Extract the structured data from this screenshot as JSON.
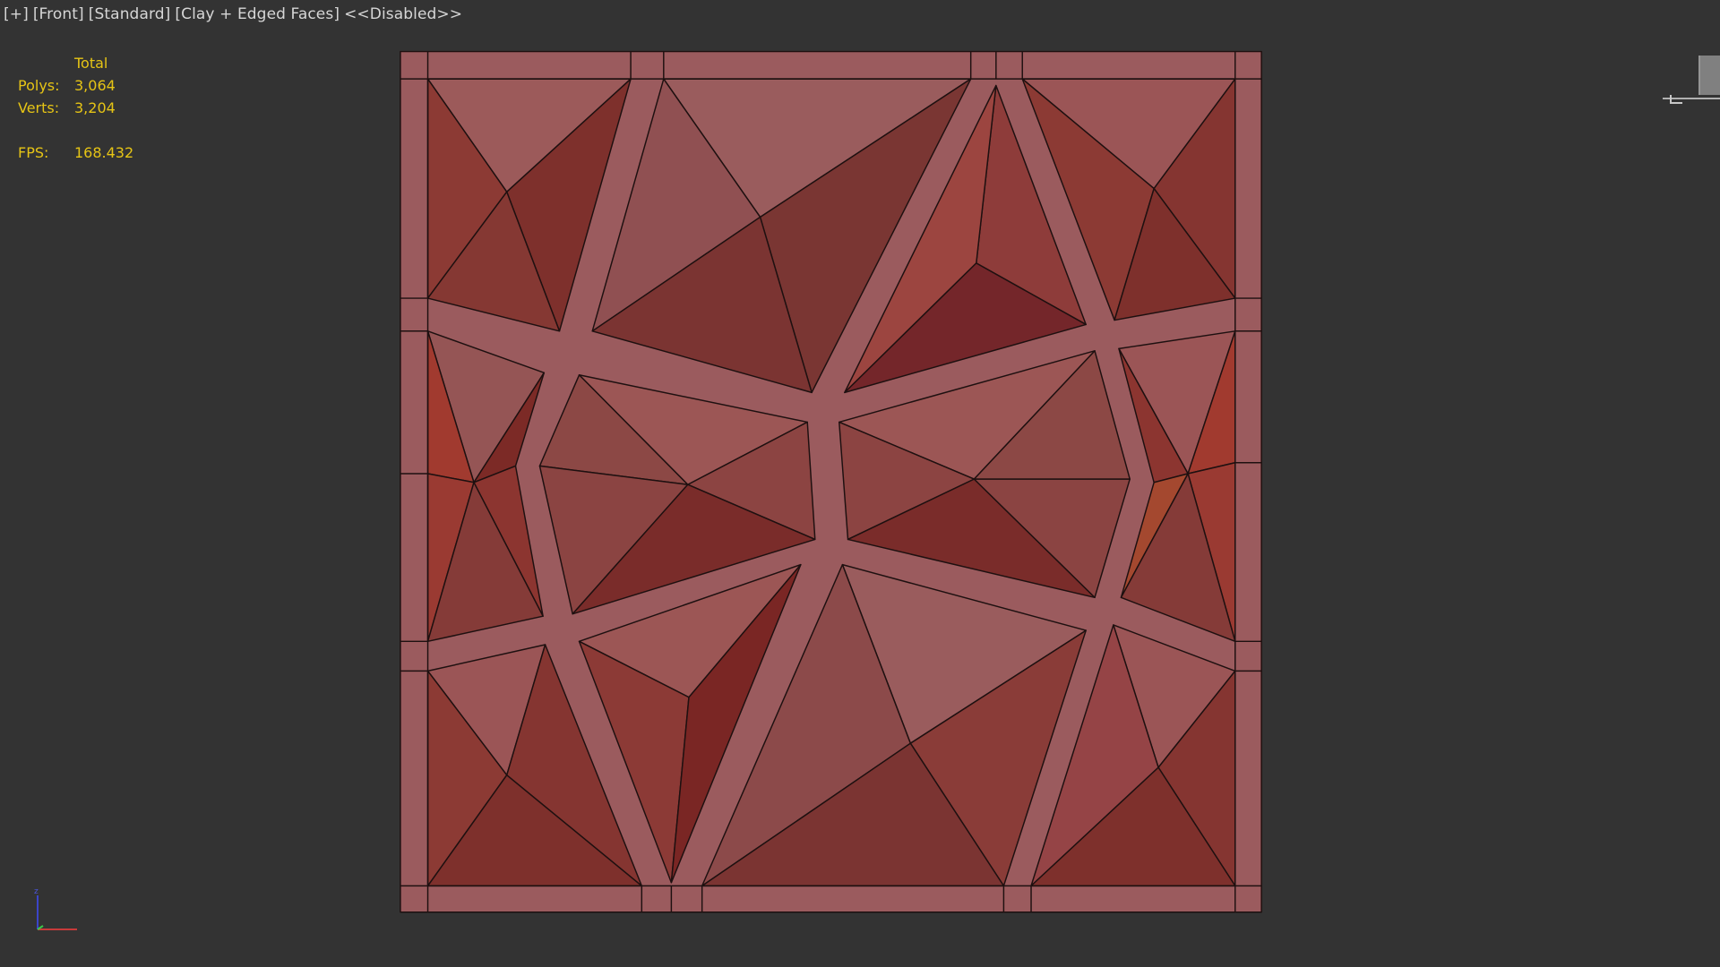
{
  "viewport": {
    "label": {
      "plus": "[+]",
      "view": "[Front]",
      "mode": "[Standard]",
      "shading": "[Clay + Edged Faces]",
      "status": "<<Disabled>>"
    }
  },
  "stats": {
    "header": "Total",
    "polys_label": "Polys:",
    "polys_value": "3,064",
    "verts_label": "Verts:",
    "verts_value": "3,204",
    "fps_label": "FPS:",
    "fps_value": "168.432"
  },
  "axis_gizmo": {
    "z_label": "z"
  },
  "colors": {
    "background": "#333333",
    "stats_text": "#e6c415",
    "label_text": "#d6d6d6",
    "mesh_frame": "#9a5a5d",
    "mesh_face_light": "#9a5a5a",
    "mesh_face_dark": "#7a2c2a",
    "mesh_face_red": "#a03a34",
    "edge": "#1e1010"
  },
  "icons": {
    "viewcube": "viewcube-icon",
    "axis": "axis-tripod-icon"
  }
}
